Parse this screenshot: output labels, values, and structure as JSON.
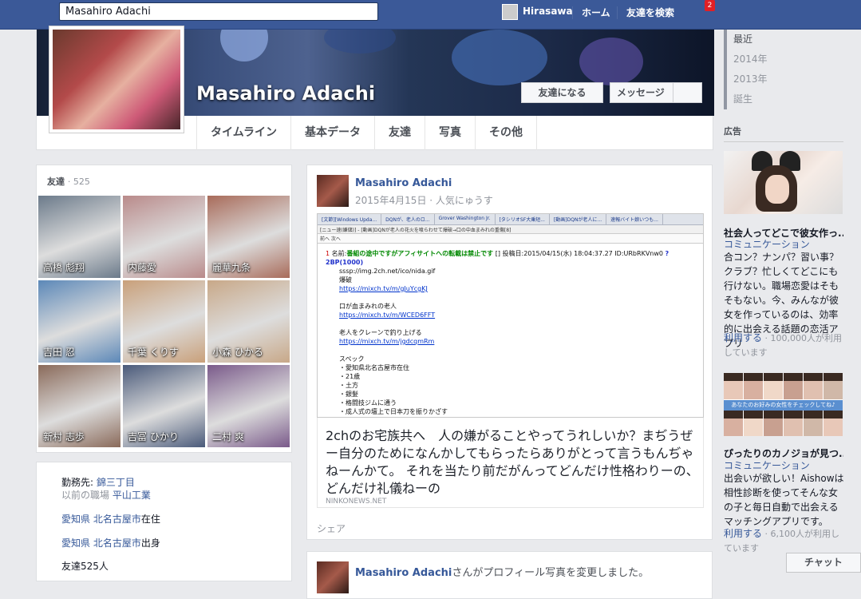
{
  "topbar": {
    "search_value": "Masahiro Adachi",
    "user_name": "Hirasawa",
    "home": "ホーム",
    "find_friends": "友達を検索",
    "notification_count": "2"
  },
  "profile": {
    "name": "Masahiro Adachi",
    "add_friend": "友達になる",
    "message": "メッセージ",
    "tabs": [
      "タイムライン",
      "基本データ",
      "友達",
      "写真",
      "その他"
    ]
  },
  "year_nav": [
    "最近",
    "2014年",
    "2013年",
    "誕生"
  ],
  "friends": {
    "title": "友達",
    "count": "· 525",
    "items": [
      {
        "name": "高橋 彪翔",
        "color": "#6b7a8a"
      },
      {
        "name": "内藤愛",
        "color": "#b98a8a"
      },
      {
        "name": "麗華九条",
        "color": "#a86b5a"
      },
      {
        "name": "吉田 忍",
        "color": "#5c88b8"
      },
      {
        "name": "千葉 くりす",
        "color": "#c9a07a"
      },
      {
        "name": "小森 ひかる",
        "color": "#c8a888"
      },
      {
        "name": "新村 志歩",
        "color": "#8a6a5a"
      },
      {
        "name": "吉冨 ひかり",
        "color": "#4a5a7a"
      },
      {
        "name": "二村 爽",
        "color": "#7a5a8a"
      }
    ]
  },
  "about": {
    "work_label": "勤務先:",
    "work_value": "錦三丁目",
    "prev_work_label": "以前の職場",
    "prev_work_value": "平山工業",
    "lives_place": "愛知県 北名古屋市",
    "lives_suffix": "在住",
    "from_place": "愛知県 北名古屋市",
    "from_suffix": "出身",
    "friends_count": "友達525人"
  },
  "post": {
    "author": "Masahiro Adachi",
    "meta": "2015年4月15日 · 人気にゅうす",
    "screenshot": {
      "tabs": [
        "[文節][Windows Upda...",
        "DQNが、老人のロ...",
        "Grover Washington Jr.",
        "[タシリオSF大乗短...",
        "[動画]DQNが老人に...",
        "速報バイト娘いつも..."
      ],
      "thread_title": "[ニュー速(嫌儲)] - [動画]DQNが老人の花火を喰らわせて爆破→口の中血まみれの重傷[8]",
      "toolbar": "前へ 次へ",
      "header_num": "1",
      "header_name": "名前:",
      "header_hl": "番組の途中ですがアフィサイトへの転載は禁止です",
      "header_date": "[] 投稿日:2015/04/15(水) 18:04:37.27 ID:URbRKVnw0",
      "header_link": "?2BP(1000)",
      "lines": [
        {
          "t": "sssp://img.2ch.net/ico/nida.gif",
          "c": ""
        },
        {
          "t": "爆破",
          "c": ""
        },
        {
          "t": "https://mixch.tv/m/gJuYcgKJ",
          "c": "u"
        },
        {
          "t": "",
          "c": ""
        },
        {
          "t": "口が血まみれの老人",
          "c": ""
        },
        {
          "t": "https://mixch.tv/m/WCED6FFT",
          "c": "u"
        },
        {
          "t": "",
          "c": ""
        },
        {
          "t": "老人をクレーンで釣り上げる",
          "c": ""
        },
        {
          "t": "https://mixch.tv/m/jgdcqmRm",
          "c": "u"
        },
        {
          "t": "",
          "c": ""
        },
        {
          "t": "スペック",
          "c": ""
        },
        {
          "t": "・愛知県北名古屋市在住",
          "c": ""
        },
        {
          "t": "・21歳",
          "c": ""
        },
        {
          "t": "・土方",
          "c": ""
        },
        {
          "t": "・銀髪",
          "c": ""
        },
        {
          "t": "・格闘技ジムに通う",
          "c": ""
        },
        {
          "t": "・成人式の壇上で日本刀を振りかざす",
          "c": ""
        }
      ]
    },
    "article_text": "2chのお宅族共へ　人の嫌がることやってうれしいか？まぢうぜー自分のためになんかしてもらったらありがとって言うもんぢゃねーんかて。 それを当たり前だがんってどんだけ性格わりーの、どんだけ礼儀ねーの",
    "article_source": "NINKONEWS.NET",
    "share": "シェア"
  },
  "post2": {
    "author": "Masahiro Adachi",
    "action": "さんがプロフィール写真を変更しました。"
  },
  "ads": {
    "title": "広告",
    "items": [
      {
        "title": "社会人ってどこで彼女作っ...",
        "category": "コミュニケーション",
        "body": "合コン？ナンパ？習い事？クラブ？忙しくてどこにも行けない。職場恋愛はそもそもない。今、みんなが彼女を作っているのは、効率的に出会える話題の恋活アプリ",
        "cta": "利用する",
        "foot": "· 100,000人が利用しています"
      },
      {
        "title": "ぴったりのカノジョが見つ...",
        "category": "コミュニケーション",
        "body": "出会いが欲しい！Aishowは相性診断を使ってそんな女の子と毎日自動で出会えるマッチングアプリです。",
        "cta": "利用する",
        "foot": "· 6,100人が利用しています",
        "banner": "あなたのお好みの女性をチェックしてね♪"
      }
    ]
  },
  "chat": "チャット"
}
